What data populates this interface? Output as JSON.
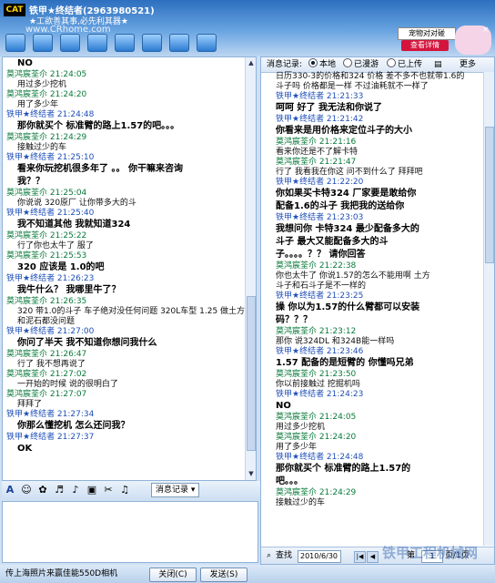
{
  "window": {
    "logo": "CAT",
    "title": "铁甲★终结者(2963980521)",
    "subtitle": "★工欲善其事,必先利其器★",
    "watermark_top": "www.CRhome.com"
  },
  "ad": {
    "label": "宠物对对碰",
    "button": "查看详情",
    "close": "×"
  },
  "left_messages": [
    {
      "k": "b",
      "v": "NO"
    },
    {
      "k": "s1",
      "v": "莫鸿宸荃尒   21:24:05"
    },
    {
      "k": "t",
      "v": "用过多少挖机"
    },
    {
      "k": "s1",
      "v": "莫鸿宸荃尒   21:24:20"
    },
    {
      "k": "t",
      "v": "用了多少年"
    },
    {
      "k": "s2",
      "v": "铁甲★终结者   21:24:48"
    },
    {
      "k": "b",
      "v": "那你就买个 标准臂的路上1.57的吧。。。"
    },
    {
      "k": "s1",
      "v": "莫鸿宸荃尒   21:24:29"
    },
    {
      "k": "t",
      "v": "接触过少的车"
    },
    {
      "k": "s2",
      "v": "铁甲★终结者   21:25:10"
    },
    {
      "k": "b",
      "v": "看来你玩挖机很多年了 。。 你干嘛来咨询"
    },
    {
      "k": "b",
      "v": "我？？"
    },
    {
      "k": "s1",
      "v": "莫鸿宸荃尒   21:25:04"
    },
    {
      "k": "t",
      "v": "你说说 320原厂 让你带多大的斗"
    },
    {
      "k": "s2",
      "v": "铁甲★终结者   21:25:40"
    },
    {
      "k": "b",
      "v": "我不知道其他  我就知道324"
    },
    {
      "k": "s1",
      "v": "莫鸿宸荃尒   21:25:22"
    },
    {
      "k": "t",
      "v": "行了你也太牛了 服了"
    },
    {
      "k": "s1",
      "v": "莫鸿宸荃尒   21:25:53"
    },
    {
      "k": "b",
      "v": "320 应该是 1.0的吧"
    },
    {
      "k": "s2",
      "v": "铁甲★终结者   21:26:23"
    },
    {
      "k": "b",
      "v": "我牛什么？  我哪里牛了？"
    },
    {
      "k": "s1",
      "v": "莫鸿宸荃尒   21:26:35"
    },
    {
      "k": "t",
      "v": "320 带1.0的斗子  车子绝对没任何问题 320L车型 1.25 做土方"
    },
    {
      "k": "t",
      "v": "和泥石都没问题"
    },
    {
      "k": "s2",
      "v": "铁甲★终结者   21:27:00"
    },
    {
      "k": "b",
      "v": "你问了半天 我不知道你想问我什么"
    },
    {
      "k": "s1",
      "v": "莫鸿宸荃尒   21:26:47"
    },
    {
      "k": "t",
      "v": "行了 我不想再说了"
    },
    {
      "k": "s1",
      "v": "莫鸿宸荃尒   21:27:02"
    },
    {
      "k": "t",
      "v": "一开始的时候 说的很明白了"
    },
    {
      "k": "s1",
      "v": "莫鸿宸荃尒   21:27:07"
    },
    {
      "k": "t",
      "v": "拜拜了"
    },
    {
      "k": "s2",
      "v": "铁甲★终结者   21:27:34"
    },
    {
      "k": "b",
      "v": "你那么懂挖机 怎么还问我？"
    },
    {
      "k": "s2",
      "v": "铁甲★终结者   21:27:37"
    },
    {
      "k": "b",
      "v": "OK"
    }
  ],
  "right_header": {
    "label": "消息记录:",
    "opt1": "本地",
    "opt2": "已漫游",
    "opt3": "已上传",
    "more": "更多"
  },
  "right_messages": [
    {
      "k": "t",
      "v": "日历330-3的价格和324 价格 差不多不也就带1.6的"
    },
    {
      "k": "t",
      "v": "斗子吗  价格都是一样 不过油耗就不一样了"
    },
    {
      "k": "s2",
      "v": "铁甲★终结者   21:21:33"
    },
    {
      "k": "b",
      "v": "呵呵   好了  我无法和你说了"
    },
    {
      "k": "s2",
      "v": "铁甲★终结者   21:21:42"
    },
    {
      "k": "b",
      "v": "你看来是用价格来定位斗子的大小"
    },
    {
      "k": "s1",
      "v": "莫鸿宸荃尒   21:21:16"
    },
    {
      "k": "t",
      "v": "看来你还是不了解卡特"
    },
    {
      "k": "s1",
      "v": "莫鸿宸荃尒   21:21:47"
    },
    {
      "k": "t",
      "v": "行了  我看我在你这 问不到什么了 拜拜吧"
    },
    {
      "k": "s2",
      "v": "铁甲★终结者   21:22:20"
    },
    {
      "k": "b",
      "v": "你如果买卡特324  厂家要是敢给你"
    },
    {
      "k": "b",
      "v": "配备1.6的斗子 我把我的送给你"
    },
    {
      "k": "s2",
      "v": "铁甲★终结者   21:23:03"
    },
    {
      "k": "b",
      "v": "我想问你 卡特324 最少配备多大的"
    },
    {
      "k": "b",
      "v": "斗子   最大又能配备多大的斗"
    },
    {
      "k": "b",
      "v": "子。。。。？？  请你回答"
    },
    {
      "k": "s1",
      "v": "莫鸿宸荃尒   21:22:38"
    },
    {
      "k": "t",
      "v": "你也太牛了         你说1.57的怎么不能用啊   土方"
    },
    {
      "k": "t",
      "v": "斗子和石斗子是不一样的"
    },
    {
      "k": "s2",
      "v": "铁甲★终结者   21:23:25"
    },
    {
      "k": "b",
      "v": "操 你以为1.57的什么臂都可以安装"
    },
    {
      "k": "b",
      "v": "码？？？"
    },
    {
      "k": "s1",
      "v": "莫鸿宸荃尒   21:23:12"
    },
    {
      "k": "t",
      "v": "那你 说324DL 和324B能一样吗"
    },
    {
      "k": "s2",
      "v": "铁甲★终结者   21:23:46"
    },
    {
      "k": "b",
      "v": "1.57 配备的是短臂的 你懂吗兄弟"
    },
    {
      "k": "s1",
      "v": "莫鸿宸荃尒   21:23:50"
    },
    {
      "k": "t",
      "v": "你以前接触过 挖掘机吗"
    },
    {
      "k": "s2",
      "v": "铁甲★终结者   21:24:23"
    },
    {
      "k": "b",
      "v": "NO"
    },
    {
      "k": "s1",
      "v": "莫鸿宸荃尒   21:24:05"
    },
    {
      "k": "t",
      "v": "用过多少挖机"
    },
    {
      "k": "s1",
      "v": "莫鸿宸荃尒   21:24:20"
    },
    {
      "k": "t",
      "v": "用了多少年"
    },
    {
      "k": "s2",
      "v": "铁甲★终结者   21:24:48"
    },
    {
      "k": "b",
      "v": "那你就买个 标准臂的路上1.57的"
    },
    {
      "k": "b",
      "v": "吧。。。"
    },
    {
      "k": "s1",
      "v": "莫鸿宸荃尒   21:24:29"
    },
    {
      "k": "t",
      "v": "接触过少的车"
    }
  ],
  "right_footer": {
    "search": "查找",
    "date": "2010/6/30",
    "page_prefix": "第",
    "page": "1",
    "page_suffix": "页/1页"
  },
  "format_toolbar": {
    "record": "消息记录 ▾"
  },
  "bottom": {
    "status": "传上海照片来赢佳能550D相机",
    "close": "关闭(C)",
    "send": "发送(S)",
    "watermark": "铁甲工程机械网"
  }
}
